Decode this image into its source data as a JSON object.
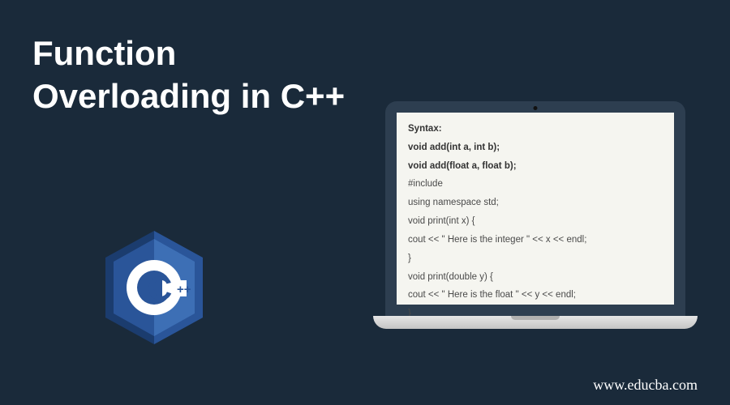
{
  "headline": "Function Overloading in C++",
  "logo": {
    "label": "C",
    "suffix": "++"
  },
  "code": {
    "syntax_title": "Syntax:",
    "syntax_line1": "void add(int a, int b);",
    "syntax_line2": "void add(float a, float b);",
    "line1": "#include",
    "line2": "using namespace std;",
    "line3": "void print(int x) {",
    "line4": "cout << \" Here is the integer \" << x << endl;",
    "line5": "}",
    "line6": "void print(double  y) {",
    "line7": "cout << \" Here is the float \" << y << endl;",
    "line8": "}"
  },
  "footer": {
    "url": "www.educba.com"
  }
}
